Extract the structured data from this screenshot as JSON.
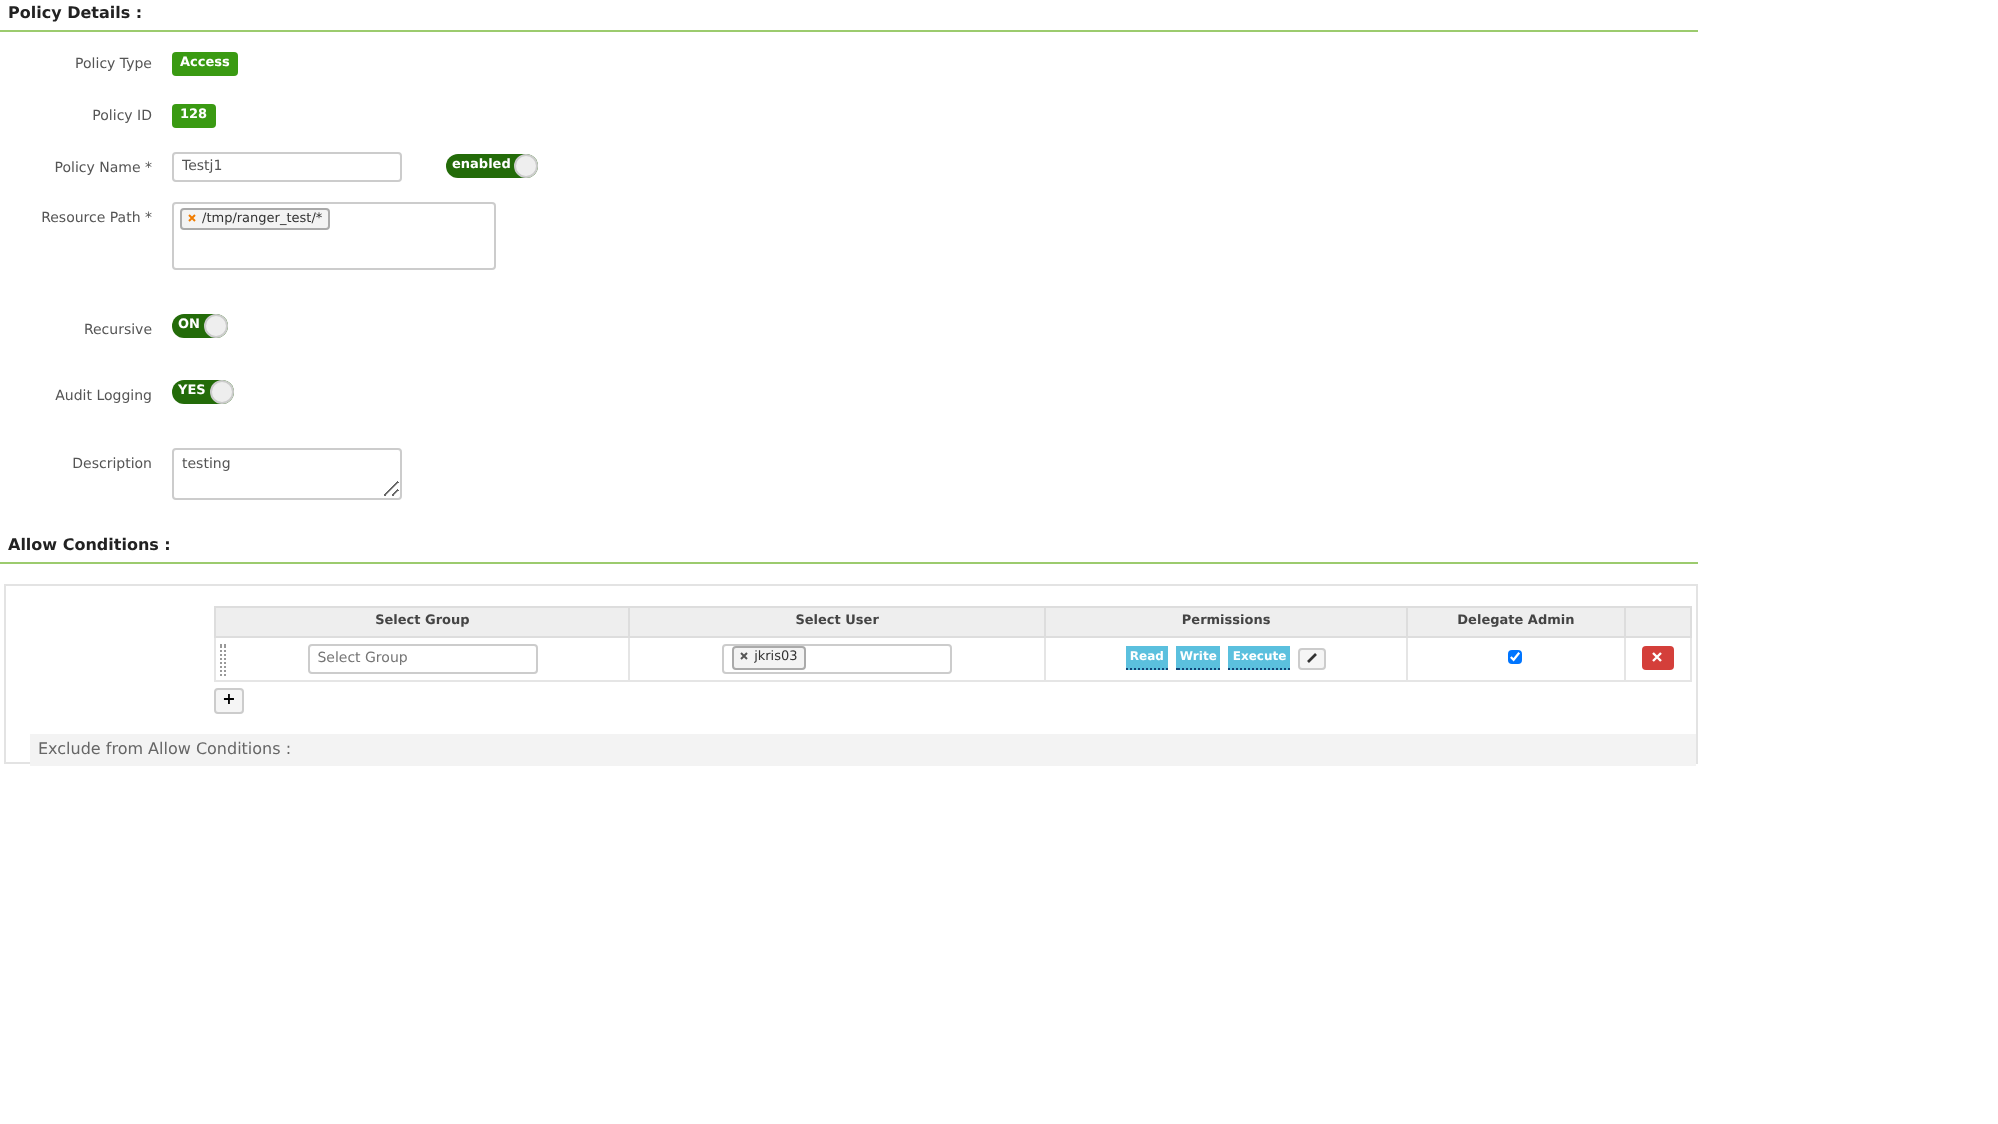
{
  "policy_details": {
    "heading": "Policy Details :",
    "fields": [
      {
        "kind": "badge",
        "label": "Policy Type",
        "value": "Access"
      },
      {
        "kind": "badge",
        "label": "Policy ID",
        "value": "128"
      },
      {
        "kind": "text",
        "label": "Policy Name *",
        "value": "Testj1",
        "toggle": {
          "text": "enabled",
          "on": true
        }
      },
      {
        "kind": "tags",
        "label": "Resource Path *",
        "tags": [
          "/tmp/ranger_test/*"
        ]
      },
      {
        "kind": "toggle",
        "label": "Recursive",
        "toggle": {
          "text": "ON",
          "on": true
        }
      },
      {
        "kind": "toggle",
        "label": "Audit Logging",
        "toggle": {
          "text": "YES",
          "on": true
        }
      },
      {
        "kind": "textarea",
        "label": "Description",
        "value": "testing"
      }
    ]
  },
  "allow_conditions": {
    "heading": "Allow Conditions :",
    "columns": [
      "Select Group",
      "Select User",
      "Permissions",
      "Delegate Admin"
    ],
    "rows": [
      {
        "group_placeholder": "Select Group",
        "users": [
          "jkris03"
        ],
        "permissions": [
          "Read",
          "Write",
          "Execute"
        ],
        "delegate_admin": true
      }
    ],
    "add_button": "+",
    "exclude_heading": "Exclude from Allow Conditions :"
  }
}
